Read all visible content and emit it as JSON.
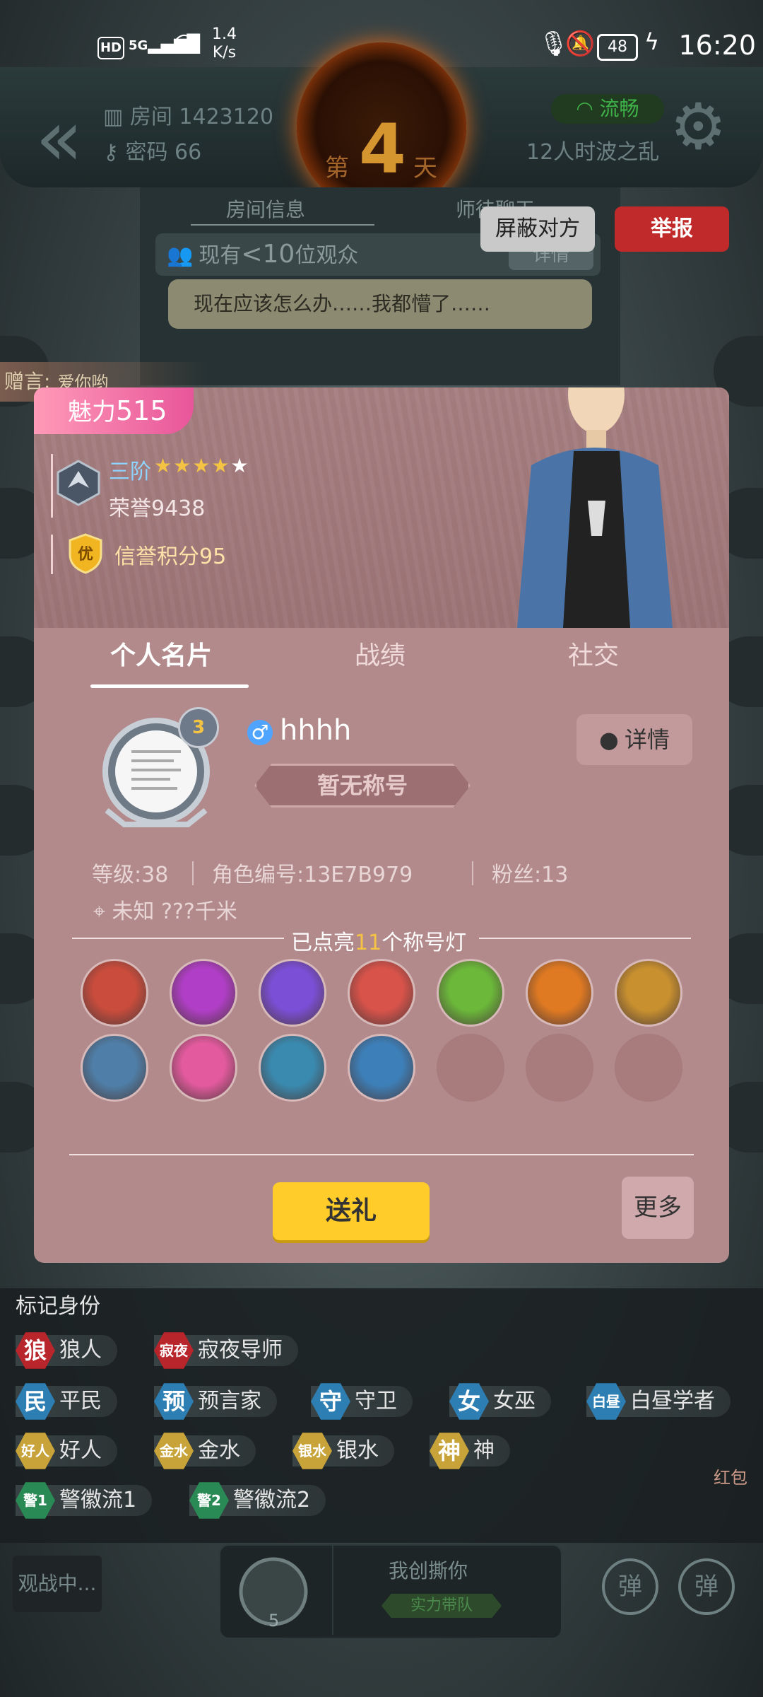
{
  "status_bar": {
    "hd": "HD",
    "network": "5G",
    "speed_value": "1.4",
    "speed_unit": "K/s",
    "battery": "48",
    "time": "16:20"
  },
  "header": {
    "room_label": "房间 1423120",
    "password_label": "密码 66",
    "day_prefix": "第",
    "day_number": "4",
    "day_suffix": "天",
    "connection": "流畅",
    "mode": "12人时波之乱"
  },
  "chat": {
    "tab_room_info": "房间信息",
    "tab_mentor_chat": "师徒聊天",
    "viewers_prefix": "现有",
    "viewers_count": "<10",
    "viewers_suffix": "位观众",
    "detail": "详情",
    "message": "现在应该怎么办……我都懵了……",
    "block_button": "屏蔽对方",
    "report_button": "举报"
  },
  "gift_message": {
    "label": "赠言:",
    "value": "爱你哟"
  },
  "profile": {
    "charm_label": "魅力",
    "charm_value": "515",
    "rank_name": "三阶",
    "rank_stars_filled": 4,
    "rank_stars_total": 5,
    "honor": "荣誉9438",
    "credit": "信誉积分95",
    "credit_badge": "优",
    "tabs": [
      "个人名片",
      "战绩",
      "社交"
    ],
    "level_bubble": "3",
    "gender_symbol": "♂",
    "nickname": "hhhh",
    "title_plate": "暂无称号",
    "detail_button": "详情",
    "stats": {
      "level": "等级:38",
      "role_id": "角色编号:13E7B979",
      "fans": "粉丝:13"
    },
    "location": "未知  ???千米",
    "lights_prefix": "已点亮",
    "lights_count": "11",
    "lights_suffix": "个称号灯",
    "lamps": [
      {
        "icon": "werewolf-icon",
        "color": "#c94c3c"
      },
      {
        "icon": "potion-icon",
        "color": "#b03ec6"
      },
      {
        "icon": "purple-mask-icon",
        "color": "#7b4fd6"
      },
      {
        "icon": "red-potions-icon",
        "color": "#d8534a"
      },
      {
        "icon": "green-scroll-icon",
        "color": "#6bb83a"
      },
      {
        "icon": "fire-hand-icon",
        "color": "#e07a22"
      },
      {
        "icon": "shield-sword-icon",
        "color": "#c8902f"
      },
      {
        "icon": "tombstone-icon",
        "color": "#4f7fa8"
      },
      {
        "icon": "pink-girl-icon",
        "color": "#e35a9e"
      },
      {
        "icon": "blue-ghost-icon",
        "color": "#3a8ab0"
      },
      {
        "icon": "ice-wolf-icon",
        "color": "#3d7fb8"
      }
    ],
    "gift_button": "送礼",
    "more_button": "更多"
  },
  "mark_identity": {
    "title": "标记身份",
    "roles": [
      {
        "hex": "狼",
        "label": "狼人",
        "color": "#b8252b"
      },
      {
        "hex": "寂夜",
        "label": "寂夜导师",
        "color": "#b8252b"
      },
      {
        "hex": "民",
        "label": "平民",
        "color": "#2d7fb3"
      },
      {
        "hex": "预",
        "label": "预言家",
        "color": "#2d7fb3"
      },
      {
        "hex": "守",
        "label": "守卫",
        "color": "#2d7fb3"
      },
      {
        "hex": "女",
        "label": "女巫",
        "color": "#2d7fb3"
      },
      {
        "hex": "白昼",
        "label": "白昼学者",
        "color": "#2d7fb3"
      },
      {
        "hex": "好人",
        "label": "好人",
        "color": "#c7a33a"
      },
      {
        "hex": "金水",
        "label": "金水",
        "color": "#c7a33a"
      },
      {
        "hex": "银水",
        "label": "银水",
        "color": "#c7a33a"
      },
      {
        "hex": "神",
        "label": "神",
        "color": "#c7a33a"
      },
      {
        "hex": "警1",
        "label": "警徽流1",
        "color": "#2a8a55"
      },
      {
        "hex": "警2",
        "label": "警徽流2",
        "color": "#2a8a55"
      }
    ]
  },
  "bottom_bar": {
    "spectating": "观战中...",
    "player_name": "我创撕你",
    "player_tag": "实力带队",
    "player_level": "5",
    "danmu": "弹",
    "red_packet": "红包"
  }
}
